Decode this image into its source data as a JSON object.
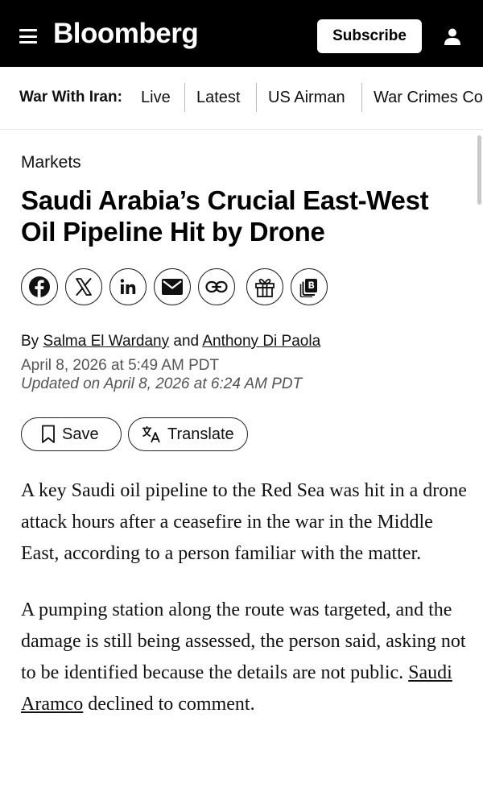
{
  "header": {
    "logo": "Bloomberg",
    "subscribe_label": "Subscribe",
    "background_color": "#000000",
    "menu_icon": "hamburger-menu-icon",
    "account_icon": "user-icon"
  },
  "subnav": {
    "title": "War With Iran:",
    "items": [
      {
        "label": "Live"
      },
      {
        "label": "Latest"
      },
      {
        "label": "US Airman"
      },
      {
        "label": "War Crimes Co"
      }
    ]
  },
  "article": {
    "section": "Markets",
    "headline": "Saudi Arabia’s Crucial East-West Oil Pipeline Hit by Drone",
    "share_icons": [
      "facebook-icon",
      "x-icon",
      "linkedin-icon",
      "email-icon",
      "link-icon",
      "gift-icon",
      "bloomberg-terminal-icon"
    ],
    "byline": {
      "prefix": "By",
      "author1": "Salma El Wardany",
      "joiner": "and",
      "author2": "Anthony Di Paola"
    },
    "published": "April 8, 2026 at 5:49 AM PDT",
    "updated": "Updated on April 8, 2026 at 6:24 AM PDT",
    "save_label": "Save",
    "translate_label": "Translate",
    "paragraph1": "A key Saudi oil pipeline to the Red Sea was hit in a drone attack hours after a ceasefire in the war in the Middle East, according to a person familiar with the matter.",
    "paragraph2_text": "A pumping station along the route was targeted, and the damage is still being assessed, the person said, asking not to be identified because the details are not public.",
    "paragraph2_link": "Saudi Aramco",
    "paragraph2_tail": "declined to comment."
  }
}
